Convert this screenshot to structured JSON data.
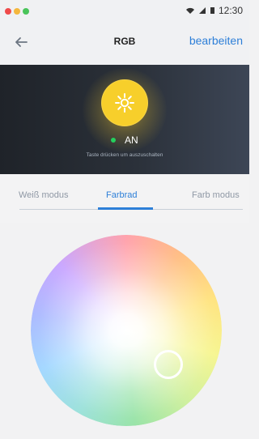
{
  "status": {
    "time": "12:30",
    "dots": [
      "#ef4a4a",
      "#f4b73d",
      "#49c45a"
    ]
  },
  "header": {
    "back_icon": "arrow-left-icon",
    "title": "RGB",
    "edit_label": "bearbeiten"
  },
  "device": {
    "state": "AN",
    "hint": "Taste drücken um auszuschalten",
    "power_icon": "sun-icon",
    "accent": "#f7cf2b"
  },
  "tabs": [
    {
      "label": "Weiß modus",
      "active": false
    },
    {
      "label": "Farbrad",
      "active": true
    },
    {
      "label": "Farb modus",
      "active": false
    }
  ],
  "wheel": {
    "selector_icon": "color-selector-icon"
  }
}
